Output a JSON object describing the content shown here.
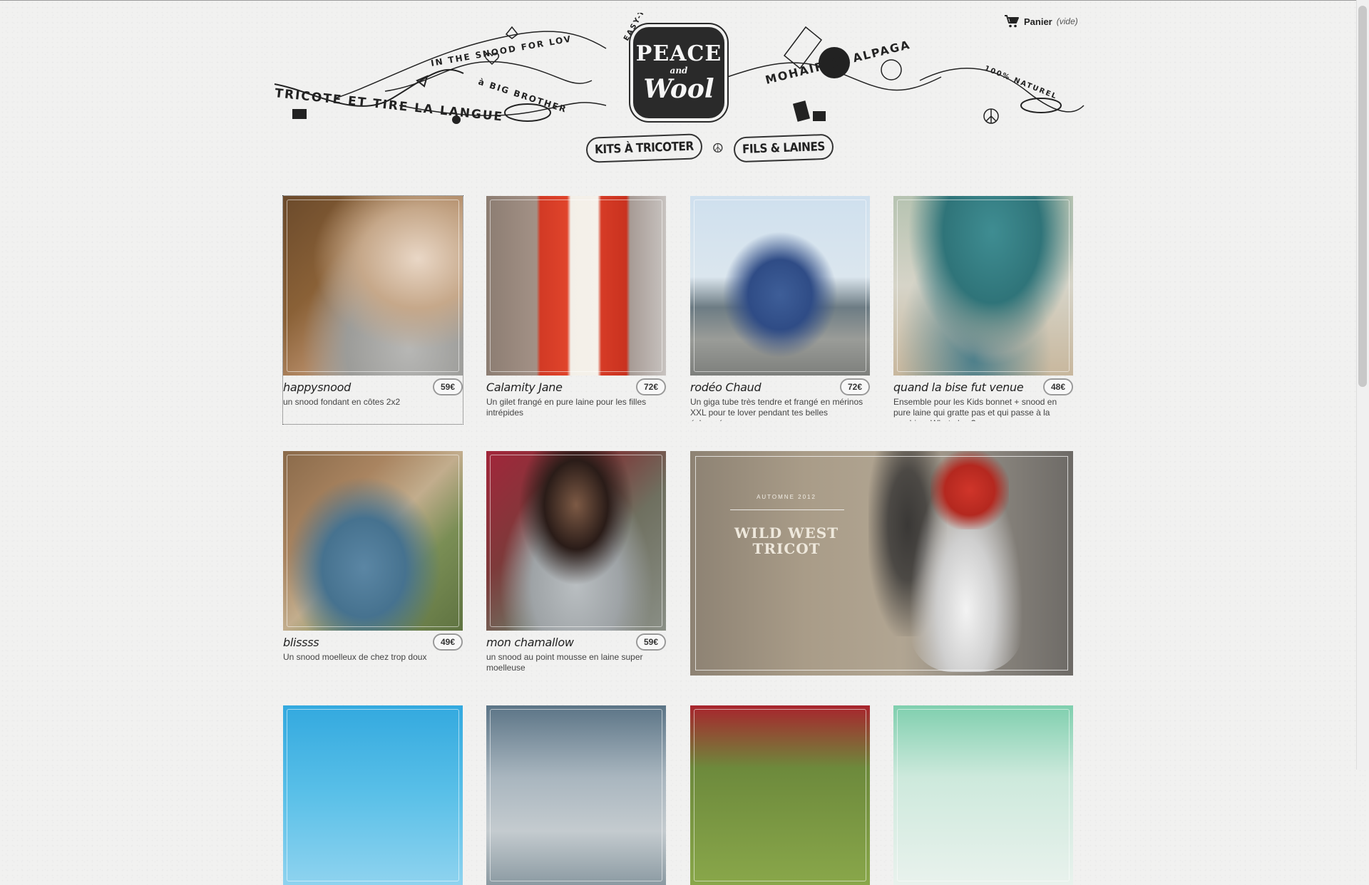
{
  "cart": {
    "label": "Panier",
    "state": "(vide)"
  },
  "logo": {
    "line1": "PEACE",
    "line2": "and",
    "line3": "Wool"
  },
  "banner": {
    "left_text": "TRICOTE ET TIRE LA LANGUE",
    "arc_text": "IN THE SNOOD FOR LOV",
    "bigbrother": "à BIG BROTHER",
    "weapons": "EASY-TO-BUILD KNITTED WEAPONS",
    "right_text": "MOHAIR ET ALPAGA",
    "naturel": "100% NATUREL"
  },
  "nav": {
    "kits": "KITS À TRICOTER",
    "separator": "☮",
    "fils": "FILS & LAINES"
  },
  "products": [
    {
      "name": "happysnood",
      "price": "59€",
      "desc": "un snood fondant en côtes 2x2"
    },
    {
      "name": "Calamity Jane",
      "price": "72€",
      "desc": "Un gilet frangé en pure laine pour les filles intrépides"
    },
    {
      "name": "rodéo Chaud",
      "price": "72€",
      "desc": "Un giga tube très tendre et frangé en mérinos XXL pour te lover pendant tes belles échappées"
    },
    {
      "name": "quand la bise fut venue",
      "price": "48€",
      "desc": "Ensemble pour les Kids bonnet + snood en pure laine qui gratte pas et qui passe à la machine. What else ?"
    },
    {
      "name": "blissss",
      "price": "49€",
      "desc": "Un snood moelleux de chez trop doux"
    },
    {
      "name": "mon chamallow",
      "price": "59€",
      "desc": "un snood au point mousse en laine super moelleuse"
    }
  ],
  "promo": {
    "season": "AUTOMNE 2012",
    "title": "WILD WEST TRICOT"
  },
  "colors": {
    "background": "#f1f1f0",
    "text": "#333333",
    "logo": "#2a2a2a",
    "promo_red": "#c9362b"
  },
  "icons": {
    "cart": "shopping-cart-icon",
    "peace": "peace-icon"
  }
}
